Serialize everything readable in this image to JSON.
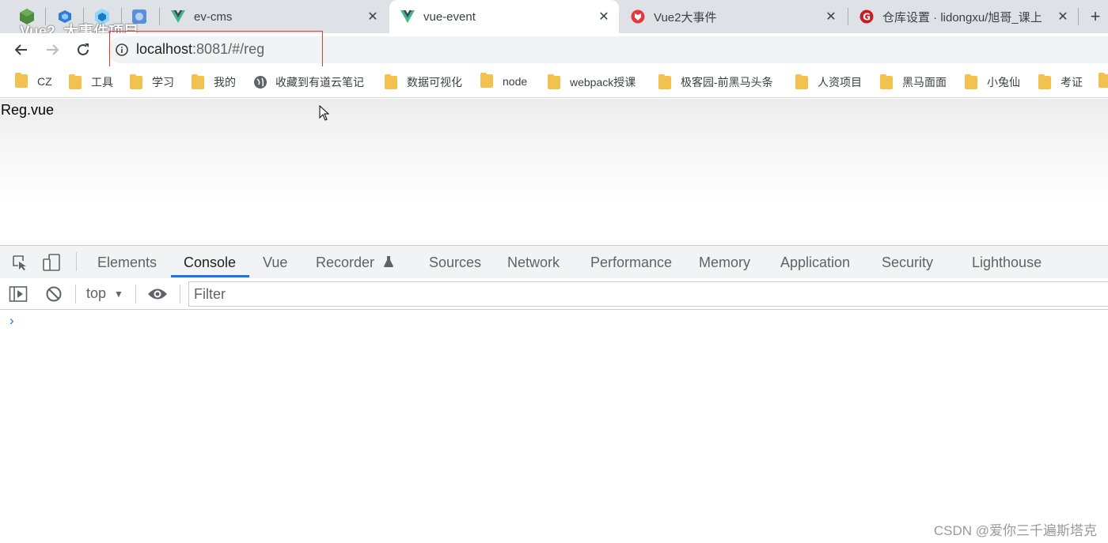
{
  "overlay_title": "Vue2_大事件项目",
  "tabs": [
    {
      "label": "ev-cms",
      "icon": "vue-logo-icon",
      "active": false
    },
    {
      "label": "vue-event",
      "icon": "vue-logo-icon",
      "active": true
    },
    {
      "label": "Vue2大事件",
      "icon": "red-shield-icon",
      "active": false
    },
    {
      "label": "仓库设置 · lidongxu/旭哥_课上",
      "icon": "gitee-logo-icon",
      "active": false
    }
  ],
  "address": {
    "host": "localhost",
    "rest": ":8081/#/reg"
  },
  "bookmarks": [
    "CZ",
    "工具",
    "学习",
    "我的",
    "收藏到有道云笔记",
    "数据可视化",
    "node",
    "webpack授课",
    "极客园-前黑马头条",
    "人资项目",
    "黑马面面",
    "小兔仙",
    "考证"
  ],
  "page": {
    "text": "Reg.vue"
  },
  "devtools": {
    "tabs": [
      "Elements",
      "Console",
      "Vue",
      "Recorder",
      "Sources",
      "Network",
      "Performance",
      "Memory",
      "Application",
      "Security",
      "Lighthouse"
    ],
    "active_tab": "Console",
    "context": "top",
    "filter_placeholder": "Filter",
    "prompt": "›"
  },
  "watermark": "CSDN @爱你三千遍斯塔克",
  "colors": {
    "accent": "#1a73e8",
    "highlight": "#e53935",
    "folder": "#f2c14e",
    "vue_green": "#41b883"
  }
}
